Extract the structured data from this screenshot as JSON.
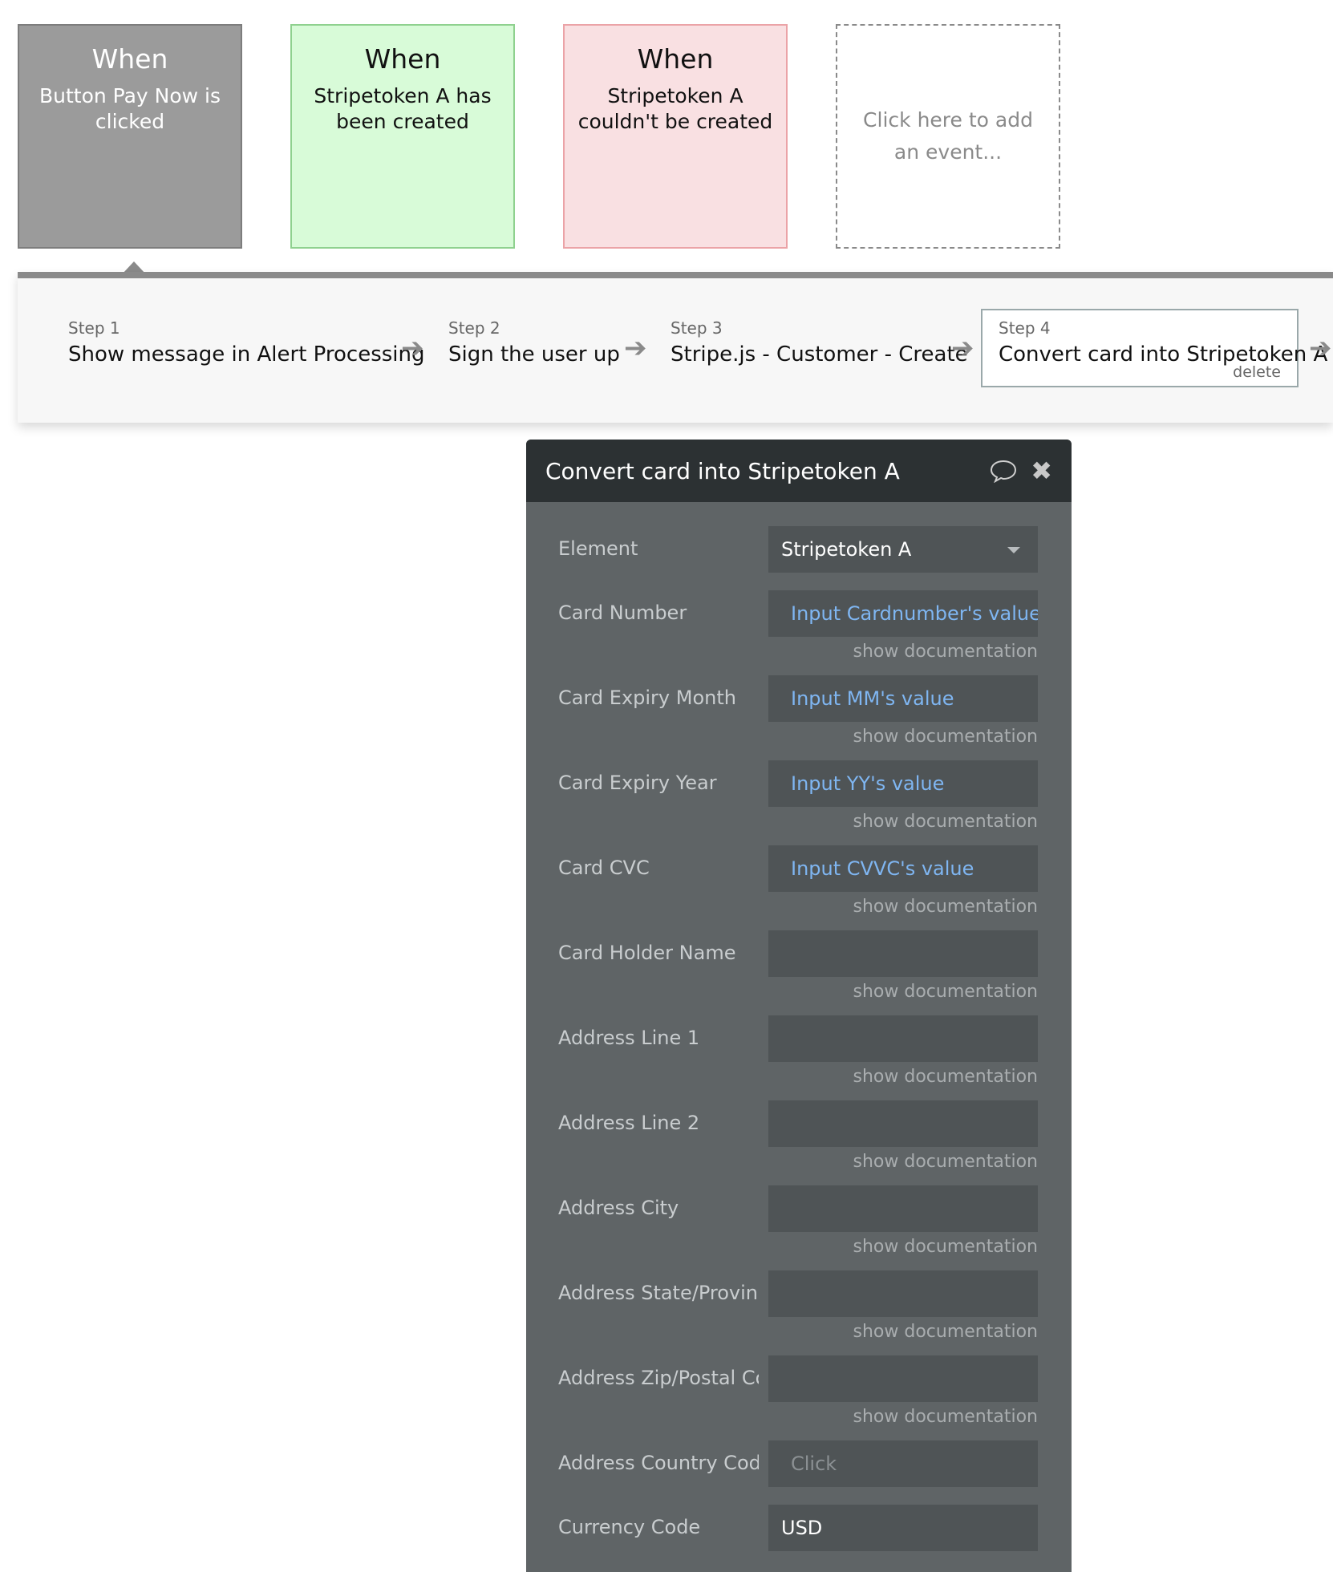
{
  "events": [
    {
      "when": "When",
      "description": "Button Pay Now is clicked"
    },
    {
      "when": "When",
      "description": "Stripetoken A has been created"
    },
    {
      "when": "When",
      "description": "Stripetoken A couldn't be created"
    }
  ],
  "add_event": {
    "label": "Click here to add an event..."
  },
  "steps": [
    {
      "number": "Step 1",
      "title": "Show message in Alert Processing"
    },
    {
      "number": "Step 2",
      "title": "Sign the user up"
    },
    {
      "number": "Step 3",
      "title": "Stripe.js - Customer - Create"
    },
    {
      "number": "Step 4",
      "title": "Convert card into Stripetoken A",
      "delete_label": "delete"
    }
  ],
  "panel": {
    "title": "Convert card into Stripetoken A",
    "doc_label": "show documentation",
    "fields": [
      {
        "label": "Element",
        "value": "Stripetoken A",
        "kind": "dropdown"
      },
      {
        "label": "Card Number",
        "value": "Input Cardnumber's value",
        "kind": "dynamic"
      },
      {
        "label": "Card Expiry Month",
        "value": "Input MM's value",
        "kind": "dynamic"
      },
      {
        "label": "Card Expiry Year",
        "value": "Input YY's value",
        "kind": "dynamic"
      },
      {
        "label": "Card CVC",
        "value": "Input CVVC's value",
        "kind": "dynamic"
      },
      {
        "label": "Card Holder Name",
        "value": "",
        "kind": "empty"
      },
      {
        "label": "Address Line 1",
        "value": "",
        "kind": "empty"
      },
      {
        "label": "Address Line 2",
        "value": "",
        "kind": "empty"
      },
      {
        "label": "Address City",
        "value": "",
        "kind": "empty"
      },
      {
        "label": "Address State/Provinc",
        "value": "",
        "kind": "empty"
      },
      {
        "label": "Address Zip/Postal Co",
        "value": "",
        "kind": "empty"
      },
      {
        "label": "Address Country Cod",
        "placeholder": "Click",
        "kind": "placeholder"
      },
      {
        "label": "Currency Code",
        "value": "USD",
        "kind": "plain"
      }
    ]
  }
}
